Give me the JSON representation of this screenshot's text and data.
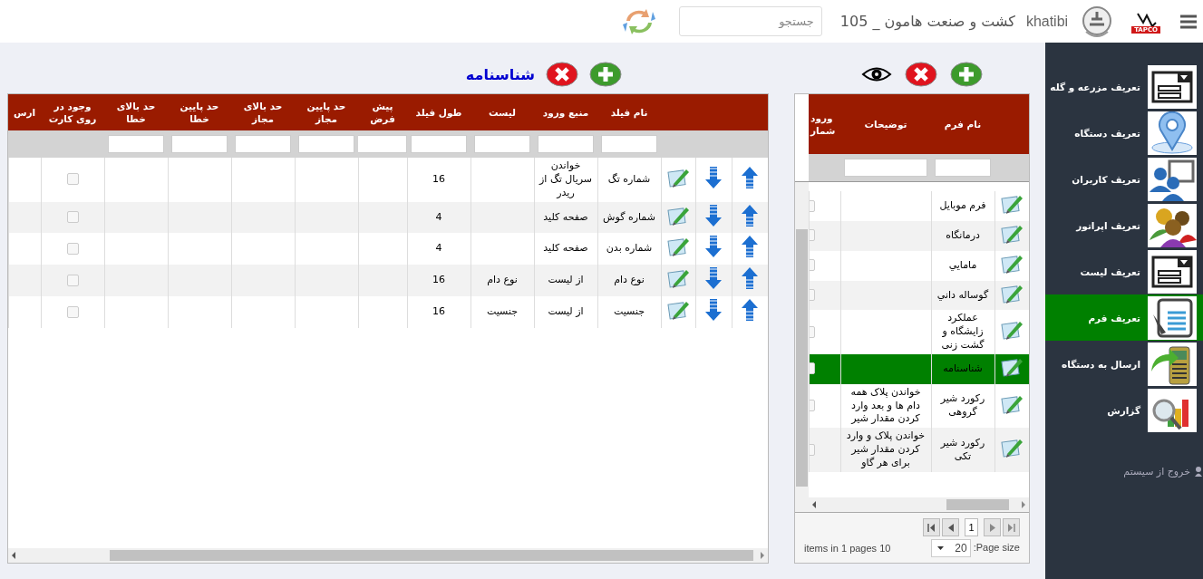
{
  "header": {
    "brand": "TAPCO",
    "user": "khatibi",
    "company": "کشت و صنعت هامون _ 105",
    "search": {
      "placeholder": "جستجو"
    }
  },
  "fields_panel": {
    "title": "شناسنامه",
    "columns": [
      "نام فیلد",
      "منبع ورود",
      "لیست",
      "طول فیلد",
      "پیش فرض",
      "حد پایین مجاز",
      "حد بالای مجاز",
      "حد پایین خطا",
      "حد بالای خطا",
      "وجود در روی کارت",
      "ارس"
    ],
    "rows": [
      {
        "name": "شماره تگ",
        "source": "خواندن سریال تگ از ریدر",
        "list": "",
        "length": "16",
        "on_card": false
      },
      {
        "name": "شماره گوش",
        "source": "صفحه کلید",
        "list": "",
        "length": "4",
        "on_card": false
      },
      {
        "name": "شماره بدن",
        "source": "صفحه کلید",
        "list": "",
        "length": "4",
        "on_card": false
      },
      {
        "name": "نوع دام",
        "source": "از لیست",
        "list": "نوع دام",
        "length": "16",
        "on_card": false
      },
      {
        "name": "جنسیت",
        "source": "از لیست",
        "list": "جنسیت",
        "length": "16",
        "on_card": false
      }
    ]
  },
  "forms_panel": {
    "columns": [
      "نام فرم",
      "توضیحات",
      "ورود شمار"
    ],
    "rows": [
      {
        "name": "فرم موبايل",
        "description": "",
        "selected": false,
        "checked": false
      },
      {
        "name": "درمانگاه",
        "description": "",
        "selected": false,
        "checked": false
      },
      {
        "name": "مامايي",
        "description": "",
        "selected": false,
        "checked": false
      },
      {
        "name": "گوساله داني",
        "description": "",
        "selected": false,
        "checked": false
      },
      {
        "name": "عملکرد زایشگاه و گشت زنی",
        "description": "",
        "selected": false,
        "checked": false
      },
      {
        "name": "شناسنامه",
        "description": "",
        "selected": true,
        "checked": false
      },
      {
        "name": "رکورد شير گروهی",
        "description": "خواندن پلاک همه دام ها و بعد وارد کردن مقدار شیر",
        "selected": false,
        "checked": false
      },
      {
        "name": "رکورد شير تکی",
        "description": "خواندن پلاک و وارد کردن مقدار شیر برای هر گاو",
        "selected": false,
        "checked": false
      }
    ],
    "pager": {
      "page": "1",
      "page_size": "20",
      "page_size_label": ":Page size",
      "summary": "items in 1 pages 10"
    }
  },
  "sidebar": {
    "items": [
      {
        "label": "تعریف مزرعه و گله",
        "selected": false
      },
      {
        "label": "تعریف دستگاه",
        "selected": false
      },
      {
        "label": "تعریف کاربران",
        "selected": false
      },
      {
        "label": "تعریف اپراتور",
        "selected": false
      },
      {
        "label": "تعریف لیست",
        "selected": false
      },
      {
        "label": "تعریف فرم",
        "selected": true
      },
      {
        "label": "ارسال به دستگاه",
        "selected": false
      },
      {
        "label": "گزارش",
        "selected": false
      }
    ],
    "logout": "خروج از سیستم"
  }
}
